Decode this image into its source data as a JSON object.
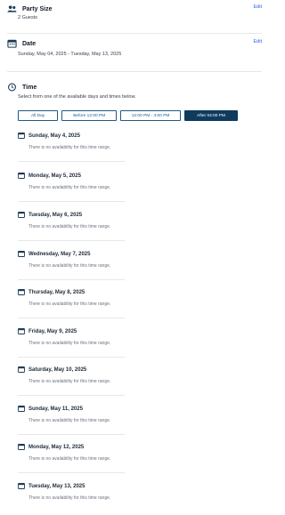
{
  "party_size": {
    "title": "Party Size",
    "value": "2 Guests",
    "edit_label": "Edit"
  },
  "date": {
    "title": "Date",
    "value": "Sunday, May 04, 2025 - Tuesday, May 13, 2025",
    "edit_label": "Edit"
  },
  "time": {
    "title": "Time",
    "instructions": "Select from one of the available days and times below.",
    "filters": [
      {
        "label": "All Day",
        "active": false
      },
      {
        "label": "Before 12:00 PM",
        "active": false
      },
      {
        "label": "12:00 PM - 4:00 PM",
        "active": false
      },
      {
        "label": "After 04:00 PM",
        "active": true
      }
    ]
  },
  "days": [
    {
      "label": "Sunday, May 4, 2025",
      "message": "There is no availability for this time range."
    },
    {
      "label": "Monday, May 5, 2025",
      "message": "There is no availability for this time range."
    },
    {
      "label": "Tuesday, May 6, 2025",
      "message": "There is no availability for this time range."
    },
    {
      "label": "Wednesday, May 7, 2025",
      "message": "There is no availability for this time range."
    },
    {
      "label": "Thursday, May 8, 2025",
      "message": "There is no availability for this time range."
    },
    {
      "label": "Friday, May 9, 2025",
      "message": "There is no availability for this time range."
    },
    {
      "label": "Saturday, May 10, 2025",
      "message": "There is no availability for this time range."
    },
    {
      "label": "Sunday, May 11, 2025",
      "message": "There is no availability for this time range."
    },
    {
      "label": "Monday, May 12, 2025",
      "message": "There is no availability for this time range."
    },
    {
      "label": "Tuesday, May 13, 2025",
      "message": "There is no availability for this time range."
    }
  ],
  "colors": {
    "accent": "#0f3b5f",
    "link": "#2563eb",
    "muted_text": "#6b7280"
  },
  "icons": {
    "party": "people-icon",
    "date": "calendar-icon",
    "time": "clock-icon",
    "day": "calendar-icon"
  }
}
